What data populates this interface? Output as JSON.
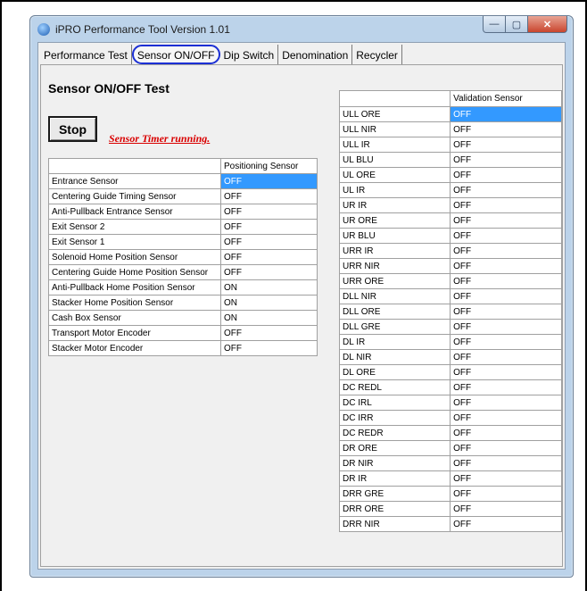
{
  "window": {
    "title": "iPRO Performance Tool Version  1.01",
    "controls": {
      "minimize": "—",
      "maximize": "▢",
      "close": "✕"
    }
  },
  "tabs": [
    {
      "label": "Performance Test"
    },
    {
      "label": "Sensor ON/OFF"
    },
    {
      "label": "Dip Switch"
    },
    {
      "label": "Denomination"
    },
    {
      "label": "Recycler"
    }
  ],
  "panel": {
    "heading": "Sensor ON/OFF Test",
    "stop_label": "Stop",
    "status_text": "Sensor Timer running.",
    "accent_color": "#1b2fd4",
    "status_color": "#d90000",
    "selection_color": "#3399ff"
  },
  "positioning": {
    "header": "Positioning Sensor",
    "rows": [
      {
        "name": "Entrance Sensor",
        "value": "OFF"
      },
      {
        "name": "Centering Guide Timing Sensor",
        "value": "OFF"
      },
      {
        "name": "Anti-Pullback Entrance Sensor",
        "value": "OFF"
      },
      {
        "name": "Exit Sensor 2",
        "value": "OFF"
      },
      {
        "name": "Exit Sensor 1",
        "value": "OFF"
      },
      {
        "name": "Solenoid Home Position Sensor",
        "value": "OFF"
      },
      {
        "name": "Centering Guide Home Position Sensor",
        "value": "OFF"
      },
      {
        "name": "Anti-Pullback Home Position Sensor",
        "value": "ON"
      },
      {
        "name": "Stacker Home Position Sensor",
        "value": "ON"
      },
      {
        "name": "Cash Box Sensor",
        "value": "ON"
      },
      {
        "name": "Transport Motor Encoder",
        "value": "OFF"
      },
      {
        "name": "Stacker Motor Encoder",
        "value": "OFF"
      }
    ]
  },
  "validation": {
    "header": "Validation Sensor",
    "rows": [
      {
        "name": "ULL ORE",
        "value": "OFF"
      },
      {
        "name": "ULL NIR",
        "value": "OFF"
      },
      {
        "name": "ULL IR",
        "value": "OFF"
      },
      {
        "name": "UL BLU",
        "value": "OFF"
      },
      {
        "name": "UL ORE",
        "value": "OFF"
      },
      {
        "name": "UL IR",
        "value": "OFF"
      },
      {
        "name": "UR IR",
        "value": "OFF"
      },
      {
        "name": "UR ORE",
        "value": "OFF"
      },
      {
        "name": "UR BLU",
        "value": "OFF"
      },
      {
        "name": "URR IR",
        "value": "OFF"
      },
      {
        "name": "URR NIR",
        "value": "OFF"
      },
      {
        "name": "URR ORE",
        "value": "OFF"
      },
      {
        "name": "DLL NIR",
        "value": "OFF"
      },
      {
        "name": "DLL ORE",
        "value": "OFF"
      },
      {
        "name": "DLL GRE",
        "value": "OFF"
      },
      {
        "name": "DL IR",
        "value": "OFF"
      },
      {
        "name": "DL NIR",
        "value": "OFF"
      },
      {
        "name": "DL ORE",
        "value": "OFF"
      },
      {
        "name": "DC REDL",
        "value": "OFF"
      },
      {
        "name": "DC IRL",
        "value": "OFF"
      },
      {
        "name": "DC IRR",
        "value": "OFF"
      },
      {
        "name": "DC REDR",
        "value": "OFF"
      },
      {
        "name": "DR ORE",
        "value": "OFF"
      },
      {
        "name": "DR NIR",
        "value": "OFF"
      },
      {
        "name": "DR IR",
        "value": "OFF"
      },
      {
        "name": "DRR GRE",
        "value": "OFF"
      },
      {
        "name": "DRR ORE",
        "value": "OFF"
      },
      {
        "name": "DRR NIR",
        "value": "OFF"
      }
    ]
  }
}
